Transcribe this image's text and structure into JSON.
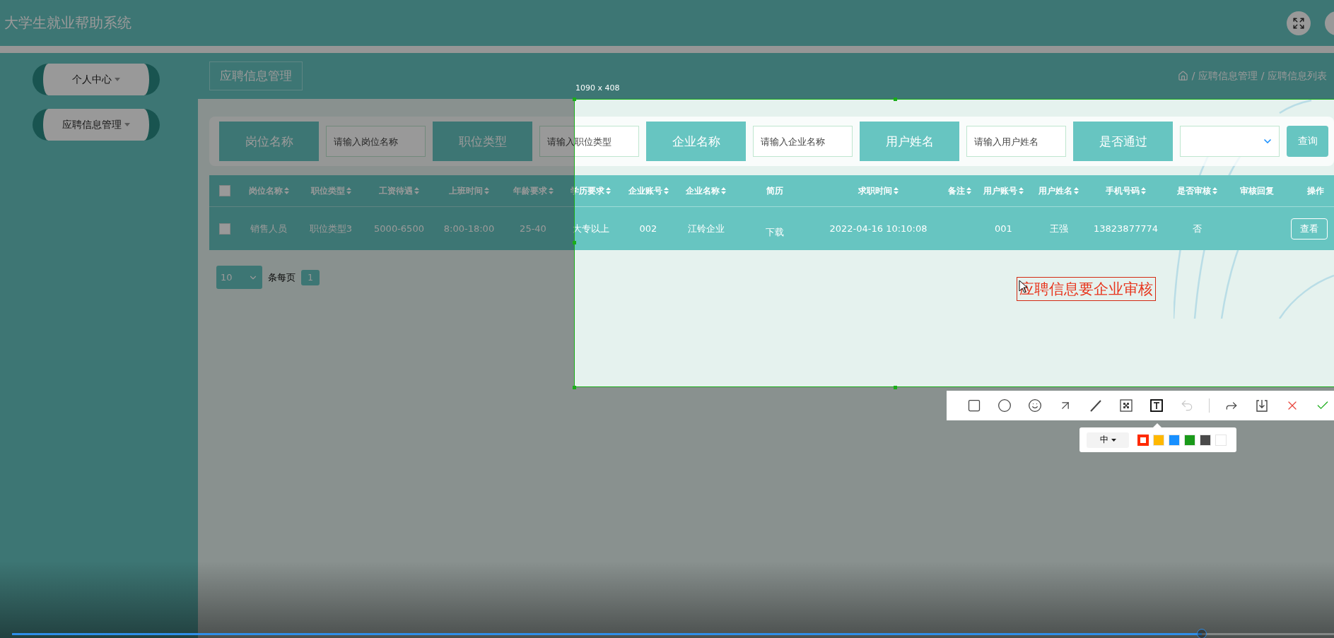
{
  "app": {
    "title": "大学生就业帮助系统"
  },
  "sidebar": {
    "items": [
      {
        "label": "个人中心"
      },
      {
        "label": "应聘信息管理"
      }
    ]
  },
  "tag": {
    "label": "应聘信息管理"
  },
  "breadcrumb": {
    "separator": "/",
    "items": [
      "应聘信息管理",
      "应聘信息列表"
    ]
  },
  "search": {
    "fields": [
      {
        "kind": "input",
        "label": "岗位名称",
        "placeholder": "请输入岗位名称"
      },
      {
        "kind": "input",
        "label": "职位类型",
        "placeholder": "请输入职位类型"
      },
      {
        "kind": "input",
        "label": "企业名称",
        "placeholder": "请输入企业名称"
      },
      {
        "kind": "input",
        "label": "用户姓名",
        "placeholder": "请输入用户姓名"
      },
      {
        "kind": "select",
        "label": "是否通过"
      }
    ],
    "button": "查询"
  },
  "table": {
    "header_checked": false,
    "columns": [
      {
        "label": "岗位名称",
        "sortable": true
      },
      {
        "label": "职位类型",
        "sortable": true
      },
      {
        "label": "工资待遇",
        "sortable": true
      },
      {
        "label": "上班时间",
        "sortable": true
      },
      {
        "label": "年龄要求",
        "sortable": true
      },
      {
        "label": "学历要求",
        "sortable": true
      },
      {
        "label": "企业账号",
        "sortable": true
      },
      {
        "label": "企业名称",
        "sortable": true
      },
      {
        "label": "简历",
        "sortable": false
      },
      {
        "label": "求职时间",
        "sortable": true
      },
      {
        "label": "备注",
        "sortable": true
      },
      {
        "label": "用户账号",
        "sortable": true
      },
      {
        "label": "用户姓名",
        "sortable": true
      },
      {
        "label": "手机号码",
        "sortable": true
      },
      {
        "label": "是否审核",
        "sortable": true
      },
      {
        "label": "审核回复",
        "sortable": false
      },
      {
        "label": "操作",
        "sortable": false
      }
    ],
    "rows": [
      {
        "checked": false,
        "cells": [
          {
            "kind": "text",
            "text": "销售人员"
          },
          {
            "kind": "text",
            "text": "职位类型3"
          },
          {
            "kind": "text",
            "text": "5000-6500"
          },
          {
            "kind": "text",
            "text": "8:00-18:00"
          },
          {
            "kind": "text",
            "text": "25-40"
          },
          {
            "kind": "text",
            "text": "大专以上"
          },
          {
            "kind": "text",
            "text": "002"
          },
          {
            "kind": "text",
            "text": "江铃企业"
          },
          {
            "kind": "link",
            "text": "下载"
          },
          {
            "kind": "text",
            "text": "2022-04-16 10:10:08"
          },
          {
            "kind": "empty"
          },
          {
            "kind": "text",
            "text": "001"
          },
          {
            "kind": "text",
            "text": "王强"
          },
          {
            "kind": "text",
            "text": "13823877774"
          },
          {
            "kind": "text",
            "text": "否"
          },
          {
            "kind": "empty"
          },
          {
            "kind": "button",
            "text": "查看"
          }
        ]
      }
    ]
  },
  "pagination": {
    "page_size": "10",
    "per_page_label": "条每页",
    "pages": [
      {
        "label": "1",
        "selected": true
      }
    ]
  },
  "capture": {
    "size_label": "1090 x 408",
    "annotation": "应聘信息要企业审核",
    "tools": [
      {
        "kind": "rectangle",
        "selected": false,
        "disabled": false
      },
      {
        "kind": "ellipse",
        "selected": false,
        "disabled": false
      },
      {
        "kind": "emoji",
        "selected": false,
        "disabled": false
      },
      {
        "kind": "arrow",
        "selected": false,
        "disabled": false
      },
      {
        "kind": "pen",
        "selected": false,
        "disabled": false
      },
      {
        "kind": "mosaic",
        "selected": false,
        "disabled": false
      },
      {
        "kind": "text",
        "selected": true,
        "disabled": false
      },
      {
        "kind": "undo",
        "disabled": true
      },
      {
        "kind": "divider"
      },
      {
        "kind": "share",
        "disabled": false
      },
      {
        "kind": "save",
        "disabled": false
      },
      {
        "kind": "cancel",
        "disabled": false
      },
      {
        "kind": "confirm",
        "disabled": false
      }
    ],
    "font_size": "中",
    "colors": [
      {
        "color": "#ff2a00",
        "selected": true
      },
      {
        "color": "#ffb800",
        "selected": false
      },
      {
        "color": "#1890ff",
        "selected": false
      },
      {
        "color": "#1a9a1a",
        "selected": false
      },
      {
        "color": "#4a4a4a",
        "selected": false
      },
      {
        "color": "#ffffff",
        "selected": false
      }
    ]
  },
  "player": {
    "level": 0.9
  }
}
